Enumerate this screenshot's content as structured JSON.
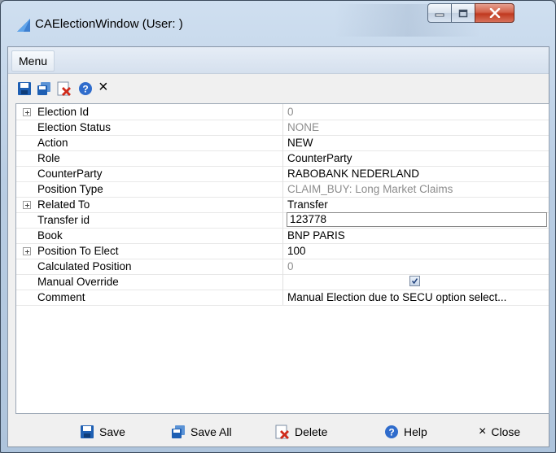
{
  "window": {
    "title": "CAElectionWindow (User: )"
  },
  "menu": {
    "items": [
      {
        "label": "Menu"
      }
    ]
  },
  "toolbar": {
    "icons": [
      "save-icon",
      "save-all-icon",
      "delete-icon",
      "help-icon",
      "close-icon"
    ],
    "close_glyph": "×"
  },
  "properties": [
    {
      "name": "Election Id",
      "value": "0",
      "expandable": true,
      "muted": true,
      "editor": "text"
    },
    {
      "name": "Election Status",
      "value": "NONE",
      "expandable": false,
      "muted": true,
      "editor": "text"
    },
    {
      "name": "Action",
      "value": "NEW",
      "expandable": false,
      "muted": false,
      "editor": "text"
    },
    {
      "name": "Role",
      "value": "CounterParty",
      "expandable": false,
      "muted": false,
      "editor": "text"
    },
    {
      "name": "CounterParty",
      "value": "RABOBANK NEDERLAND",
      "expandable": false,
      "muted": false,
      "editor": "text"
    },
    {
      "name": "Position Type",
      "value": "CLAIM_BUY: Long Market Claims",
      "expandable": false,
      "muted": true,
      "editor": "text"
    },
    {
      "name": "Related To",
      "value": "Transfer",
      "expandable": true,
      "muted": false,
      "editor": "text"
    },
    {
      "name": "Transfer id",
      "value": "123778",
      "expandable": false,
      "muted": false,
      "editor": "input"
    },
    {
      "name": "Book",
      "value": "BNP PARIS",
      "expandable": false,
      "muted": false,
      "editor": "text"
    },
    {
      "name": "Position To Elect",
      "value": "100",
      "expandable": true,
      "muted": false,
      "editor": "text"
    },
    {
      "name": "Calculated Position",
      "value": "0",
      "expandable": false,
      "muted": true,
      "editor": "text"
    },
    {
      "name": "Manual Override",
      "value": "",
      "checked": true,
      "expandable": false,
      "muted": false,
      "editor": "checkbox"
    },
    {
      "name": "Comment",
      "value": "Manual Election due to SECU option select...",
      "expandable": false,
      "muted": false,
      "editor": "text"
    }
  ],
  "buttons": {
    "save": "Save",
    "save_all": "Save All",
    "delete": "Delete",
    "help": "Help",
    "close": "Close",
    "close_glyph": "×"
  },
  "colors": {
    "muted_value": "#8d8d8d",
    "title_gradient_top": "#cfdff0",
    "close_button": "#c0391f"
  }
}
